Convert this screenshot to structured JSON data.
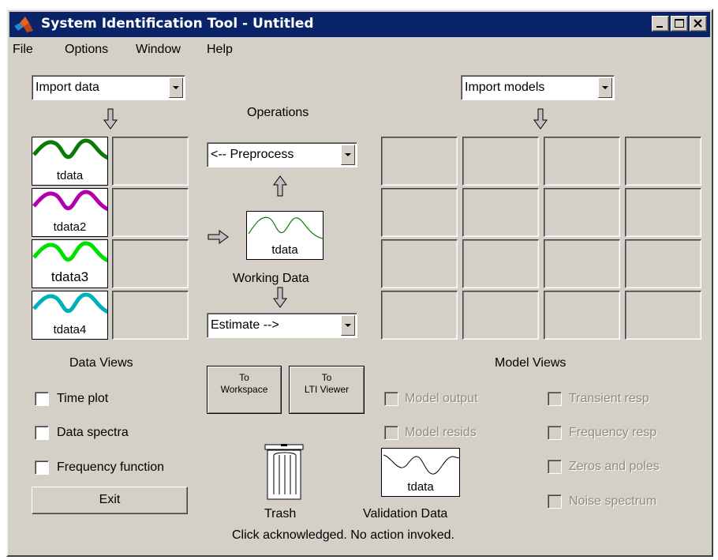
{
  "window": {
    "title": "System Identification Tool - Untitled"
  },
  "menu": [
    "File",
    "Options",
    "Window",
    "Help"
  ],
  "import_data": {
    "value": "Import data"
  },
  "import_models": {
    "value": "Import models"
  },
  "operations": {
    "label": "Operations",
    "preprocess": "<-- Preprocess",
    "estimate": "Estimate -->"
  },
  "working_data": {
    "name": "tdata",
    "label": "Working Data"
  },
  "data_items": [
    {
      "name": "tdata",
      "color": "#0a7a0a"
    },
    {
      "name": "tdata2",
      "color": "#b000b0"
    },
    {
      "name": "tdata3",
      "color": "#00e000"
    },
    {
      "name": "tdata4",
      "color": "#00b0b8"
    }
  ],
  "data_views": {
    "label": "Data Views",
    "time_plot": "Time plot",
    "data_spectra": "Data spectra",
    "frequency_function": "Frequency function"
  },
  "buttons": {
    "to_workspace_line1": "To",
    "to_workspace_line2": "Workspace",
    "to_lti_line1": "To",
    "to_lti_line2": "LTI Viewer",
    "exit": "Exit"
  },
  "trash": {
    "label": "Trash"
  },
  "validation_data": {
    "name": "tdata",
    "label": "Validation Data"
  },
  "model_views": {
    "label": "Model Views",
    "model_output": "Model output",
    "model_resids": "Model resids",
    "transient_resp": "Transient resp",
    "frequency_resp": "Frequency resp",
    "zeros_and_poles": "Zeros and poles",
    "noise_spectrum": "Noise spectrum"
  },
  "status": "Click acknowledged. No action invoked."
}
